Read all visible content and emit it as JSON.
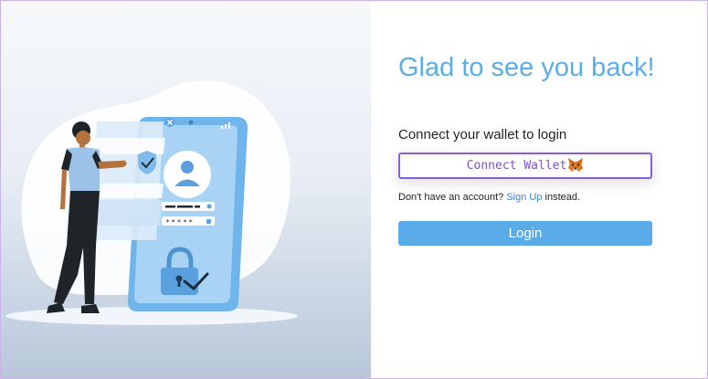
{
  "login": {
    "heading": "Glad to see you back!",
    "connect_label": "Connect your wallet to login",
    "wallet_button_label": "Connect Wallet",
    "wallet_icon": "metamask-fox-icon",
    "signup_prefix": "Don't have an account?",
    "signup_link": "Sign Up",
    "signup_suffix": "instead.",
    "login_button_label": "Login",
    "password_mask": "*****"
  },
  "colors": {
    "accent": "#5aace8",
    "heading": "#5aaee7",
    "wallet_border": "#8a5fd0",
    "link": "#3b82d6"
  }
}
